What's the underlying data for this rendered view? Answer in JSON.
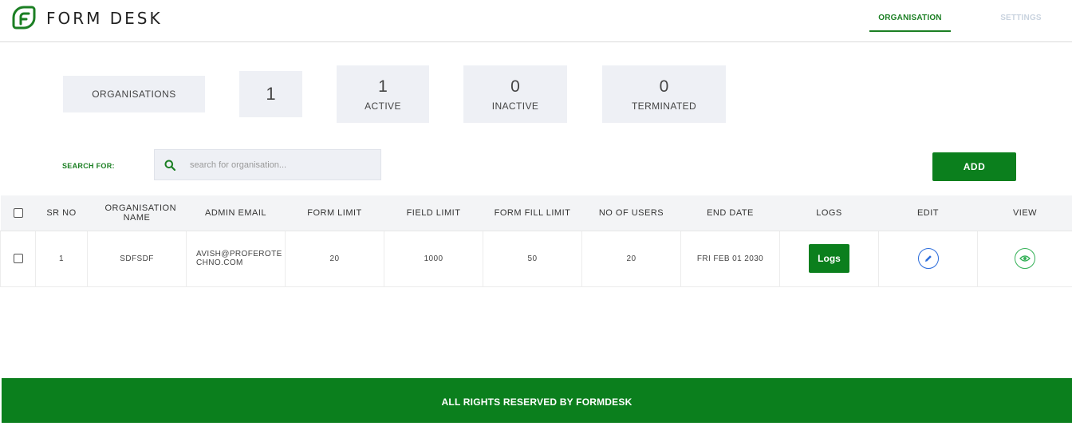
{
  "header": {
    "brand": "FORM DESK",
    "tabs": [
      {
        "label": "ORGANISATION",
        "active": true
      },
      {
        "label": "SETTINGS",
        "active": false
      }
    ]
  },
  "stats": {
    "organisations_label": "ORGANISATIONS",
    "total": "1",
    "active": {
      "value": "1",
      "label": "ACTIVE"
    },
    "inactive": {
      "value": "0",
      "label": "INACTIVE"
    },
    "terminated": {
      "value": "0",
      "label": "TERMINATED"
    }
  },
  "search": {
    "label": "SEARCH FOR:",
    "placeholder": "search for organisation..."
  },
  "add_button": "ADD",
  "table": {
    "columns": [
      "SR NO",
      "ORGANISATION NAME",
      "ADMIN EMAIL",
      "FORM LIMIT",
      "FIELD LIMIT",
      "FORM FILL LIMIT",
      "NO OF USERS",
      "END DATE",
      "LOGS",
      "EDIT",
      "VIEW"
    ],
    "rows": [
      {
        "sr_no": "1",
        "org_name": "SDFSDF",
        "admin_email": "AVISH@PROFEROTECHNO.COM",
        "form_limit": "20",
        "field_limit": "1000",
        "form_fill_limit": "50",
        "no_of_users": "20",
        "end_date": "FRI FEB 01 2030",
        "logs_label": "Logs"
      }
    ]
  },
  "footer": "ALL RIGHTS RESERVED BY FORMDESK",
  "colors": {
    "brand_green": "#0b7f1d",
    "edit_blue": "#2b6cdb",
    "view_green": "#34b157"
  },
  "icons": {
    "logo": "formdesk-leaf-logo",
    "search": "search-icon",
    "edit": "pencil-icon",
    "view": "eye-icon"
  }
}
